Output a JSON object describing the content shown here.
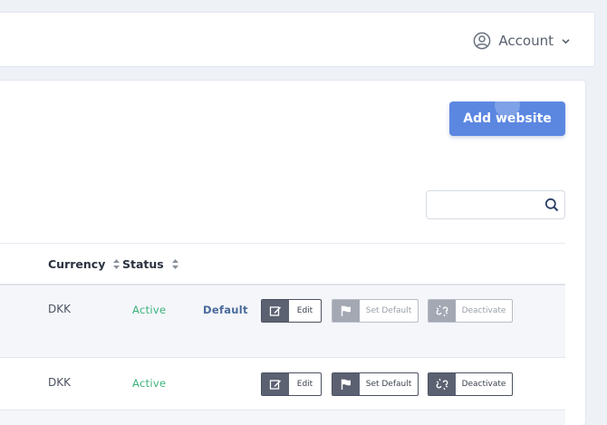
{
  "header": {
    "account_label": "Account"
  },
  "main": {
    "add_button_label": "Add website",
    "search": {
      "value": "",
      "placeholder": ""
    }
  },
  "table": {
    "columns": [
      {
        "label": "Currency",
        "sortable": true
      },
      {
        "label": "Status",
        "sortable": true
      }
    ],
    "rows": [
      {
        "currency": "DKK",
        "status": "Active",
        "default_label": "Default",
        "actions": {
          "edit": "Edit",
          "set_default": "Set Default",
          "deactivate": "Deactivate"
        },
        "set_default_enabled": false,
        "deactivate_enabled": false
      },
      {
        "currency": "DKK",
        "status": "Active",
        "default_label": "",
        "actions": {
          "edit": "Edit",
          "set_default": "Set Default",
          "deactivate": "Deactivate"
        },
        "set_default_enabled": true,
        "deactivate_enabled": true
      }
    ]
  },
  "colors": {
    "primary": "#5b87e1",
    "status_active": "#3bb27a",
    "default_text": "#4a6a9a",
    "action_dark": "#5c6172",
    "action_disabled": "#a3a8b3"
  },
  "icons": [
    "user-circle-icon",
    "chevron-down-icon",
    "search-icon",
    "sort-icon",
    "edit-icon",
    "flag-icon",
    "broken-link-icon"
  ]
}
